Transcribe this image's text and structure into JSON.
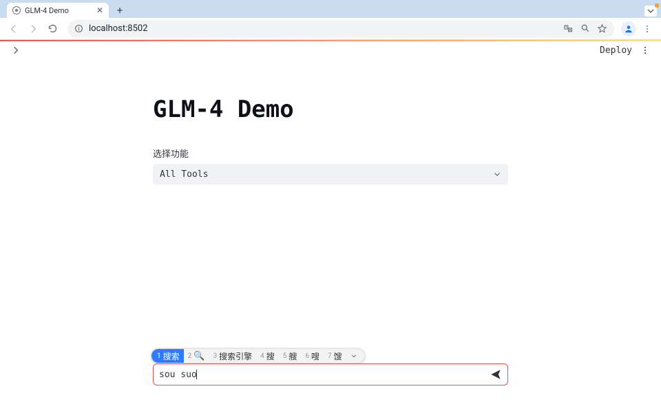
{
  "browser": {
    "tab_title": "GLM-4 Demo",
    "url": "localhost:8502"
  },
  "header": {
    "deploy_label": "Deploy"
  },
  "main": {
    "title": "GLM-4 Demo",
    "select_label": "选择功能",
    "select_value": "All Tools"
  },
  "chat": {
    "input_text": "sou suo"
  },
  "ime": {
    "candidates": [
      {
        "n": "1",
        "text": "搜索",
        "selected": true
      },
      {
        "n": "2",
        "text": "🔍",
        "icon": true
      },
      {
        "n": "3",
        "text": "搜索引擎"
      },
      {
        "n": "4",
        "text": "搜"
      },
      {
        "n": "5",
        "text": "艘"
      },
      {
        "n": "6",
        "text": "嗖"
      },
      {
        "n": "7",
        "text": "馊"
      }
    ]
  }
}
